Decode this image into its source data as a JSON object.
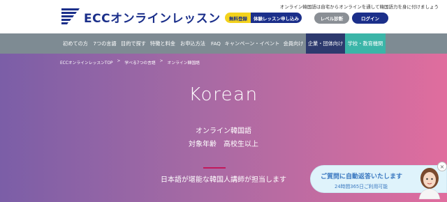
{
  "header": {
    "tagline": "オンライン韓国語は自宅からオンラインを通して韓国語力を身に付けましょう",
    "logo_text": "ECCオンラインレッスン",
    "free_signup": "無料登録",
    "trial_lesson": "体験レッスン申し込み",
    "level_check": "レベル診断",
    "login": "ログイン"
  },
  "nav": {
    "items": [
      "初めての方",
      "7つの言語",
      "目的で探す",
      "特徴と料金",
      "お申込方法",
      "FAQ",
      "キャンペーン・イベント",
      "会員向け",
      "企業・団体向け",
      "学校・教育機関"
    ]
  },
  "breadcrumb": {
    "items": [
      "ECCオンラインレッスンTOP",
      "学べる7つの言語",
      "オンライン韓国語"
    ],
    "separator": ">"
  },
  "hero": {
    "title": "Korean",
    "subtitle": "オンライン韓国語",
    "target_age": "対象年齢　高校生以上",
    "tagline": "日本語が堪能な韓国人講師が担当します"
  },
  "chat": {
    "title": "ご質問に自動返答いたします",
    "subtitle": "24時間365日ご利用可能",
    "close": "×"
  },
  "colors": {
    "brand_navy": "#1b2f8a",
    "brand_yellow": "#f3d21c",
    "nav_gray": "#7e8b93",
    "corp_blue": "#2d3a6e",
    "school_teal": "#3bb5a8",
    "accent_pink": "#c2185b"
  }
}
